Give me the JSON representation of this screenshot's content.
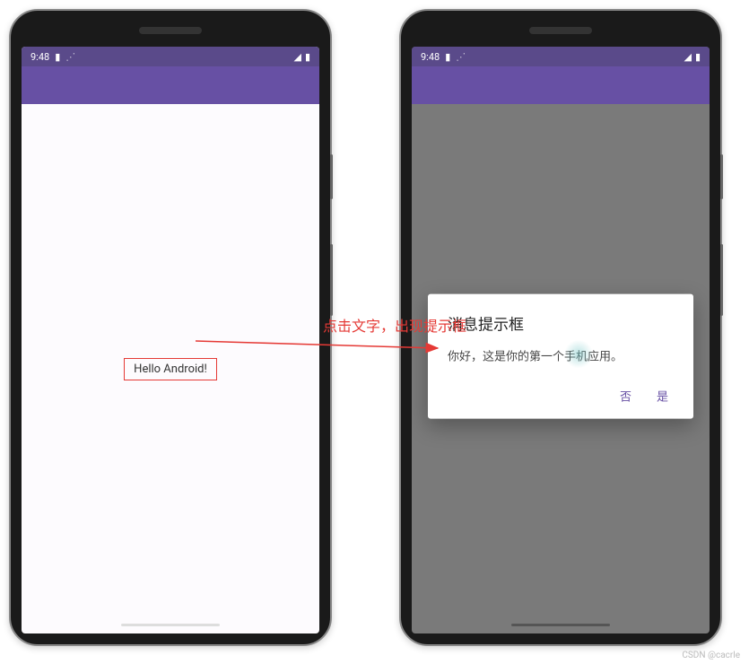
{
  "status": {
    "time": "9:48",
    "battery_icon": "🔲",
    "wifi_icon": "📶"
  },
  "left_phone": {
    "hello_text": "Hello Android!"
  },
  "right_phone": {
    "dialog": {
      "title": "消息提示框",
      "message": "你好，这是你的第一个手机应用。",
      "no_label": "否",
      "yes_label": "是"
    }
  },
  "annotation": "点击文字，出现提示框",
  "watermark": "CSDN @cacrle"
}
